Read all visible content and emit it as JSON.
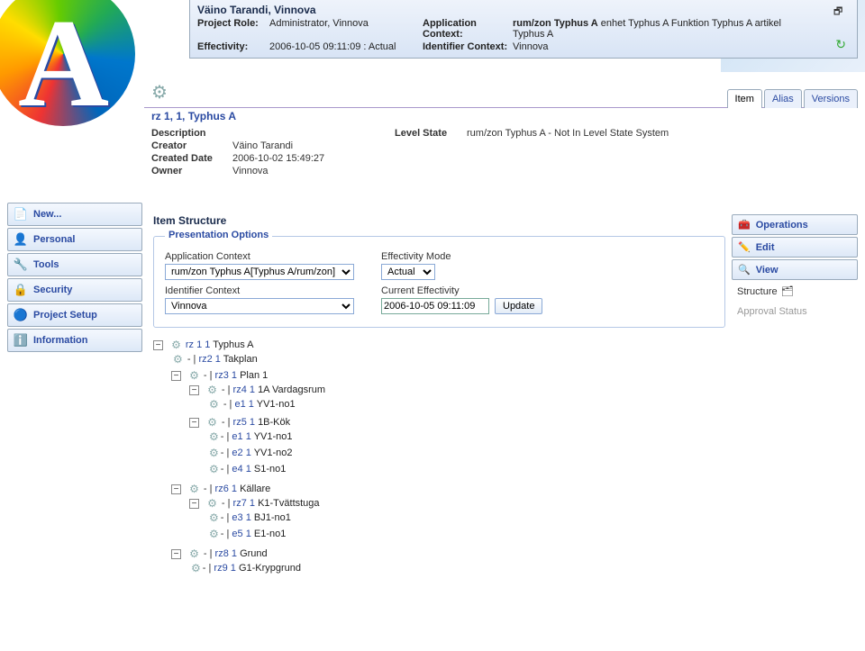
{
  "header": {
    "title": "Väino Tarandi, Vinnova",
    "project_role_label": "Project Role:",
    "project_role": "Administrator, Vinnova",
    "effectivity_label": "Effectivity:",
    "effectivity": "2006-10-05 09:11:09 : Actual",
    "app_context_label": "Application Context:",
    "app_context_bold": "rum/zon Typhus A",
    "app_context_rest": " enhet Typhus A Funktion Typhus A artikel Typhus A",
    "id_context_label": "Identifier Context:",
    "id_context": "Vinnova"
  },
  "tabs": {
    "item": "Item",
    "alias": "Alias",
    "versions": "Versions"
  },
  "object": {
    "title": "rz 1, 1, Typhus A",
    "description_label": "Description",
    "description": "",
    "level_state_label": "Level State",
    "level_state": "rum/zon Typhus A - Not In Level State System",
    "creator_label": "Creator",
    "creator": "Väino Tarandi",
    "created_label": "Created Date",
    "created": "2006-10-02 15:49:27",
    "owner_label": "Owner",
    "owner": "Vinnova"
  },
  "leftnav": {
    "new": "New...",
    "personal": "Personal",
    "tools": "Tools",
    "security": "Security",
    "project": "Project Setup",
    "information": "Information"
  },
  "section_title": "Item Structure",
  "presentation": {
    "legend": "Presentation Options",
    "app_context_label": "Application Context",
    "app_context_value": "rum/zon Typhus A[Typhus A/rum/zon]",
    "id_context_label": "Identifier Context",
    "id_context_value": "Vinnova",
    "eff_mode_label": "Effectivity Mode",
    "eff_mode_value": "Actual",
    "cur_eff_label": "Current Effectivity",
    "cur_eff_value": "2006-10-05 09:11:09",
    "update_label": "Update"
  },
  "tree": {
    "n1": {
      "link": "rz 1 1",
      "label": "Typhus A"
    },
    "n2": {
      "link": "rz2 1",
      "label": "Takplan"
    },
    "n3": {
      "link": "rz3 1",
      "label": "Plan 1"
    },
    "n4": {
      "link": "rz4 1",
      "label": "1A Vardagsrum"
    },
    "n5": {
      "link": "e1 1",
      "label": "YV1-no1"
    },
    "n6": {
      "link": "rz5 1",
      "label": "1B-Kök"
    },
    "n7": {
      "link": "e1 1",
      "label": "YV1-no1"
    },
    "n8": {
      "link": "e2 1",
      "label": "YV1-no2"
    },
    "n9": {
      "link": "e4 1",
      "label": "S1-no1"
    },
    "n10": {
      "link": "rz6 1",
      "label": "Källare"
    },
    "n11": {
      "link": "rz7 1",
      "label": "K1-Tvättstuga"
    },
    "n12": {
      "link": "e3 1",
      "label": "BJ1-no1"
    },
    "n13": {
      "link": "e5 1",
      "label": "E1-no1"
    },
    "n14": {
      "link": "rz8 1",
      "label": "Grund"
    },
    "n15": {
      "link": "rz9 1",
      "label": "G1-Krypgrund"
    }
  },
  "rightnav": {
    "operations": "Operations",
    "edit": "Edit",
    "view": "View",
    "structure": "Structure",
    "approval": "Approval Status"
  }
}
